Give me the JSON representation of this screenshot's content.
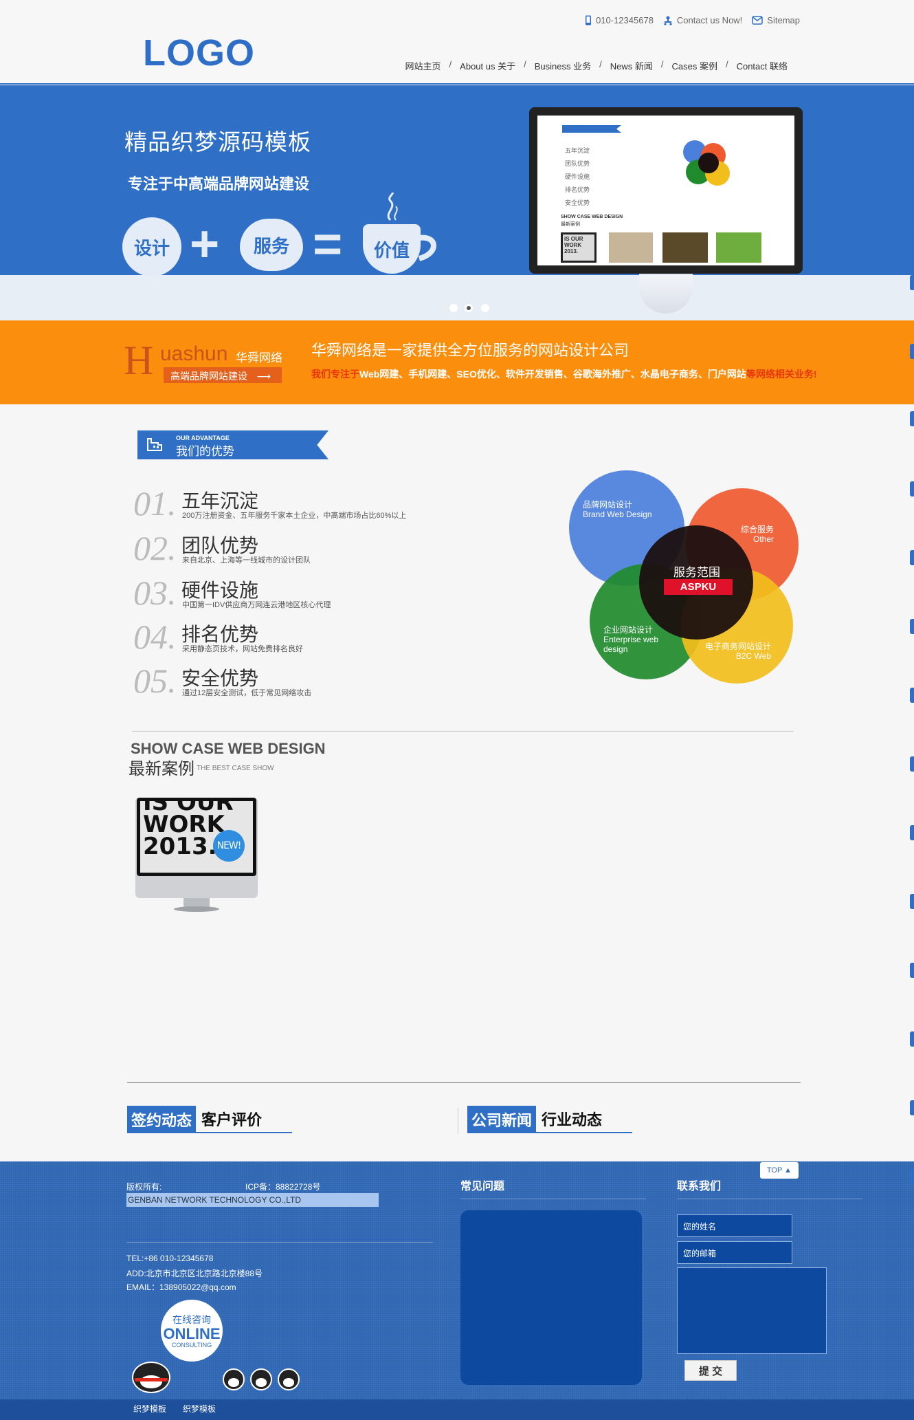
{
  "header": {
    "logo": "LOGO",
    "phone": "010-12345678",
    "contact": "Contact us Now!",
    "sitemap": "Sitemap",
    "nav": [
      "网站主页",
      "About us 关于",
      "Business 业务",
      "News 新闻",
      "Cases 案例",
      "Contact 联络"
    ],
    "separator": "/"
  },
  "banner": {
    "title": "精品织梦源码模板",
    "subtitle": "专注于中高端品牌网站建设",
    "equation": {
      "a": "设计",
      "plus": "+",
      "b": "服务",
      "equals": "=",
      "c": "价值"
    },
    "screen": {
      "items": [
        "五年沉淀",
        "团队优势",
        "硬件设施",
        "排名优势",
        "安全优势"
      ],
      "case_en": "SHOW CASE WEB DESIGN",
      "case_cn": "最新案例",
      "thumb_text": "IS OUR WORK 2013."
    },
    "slides": 3,
    "active_slide": 2
  },
  "promo": {
    "logo_h": "H",
    "logo_name": "uashun",
    "logo_cn": "华舜网络",
    "logo_tag": "高端品牌网站建设",
    "title": "华舜网络是一家提供全方位服务的网站设计公司",
    "desc_pre": "我们专注于",
    "desc_mid": "Web网建、手机网建、SEO优化、软件开发销售、谷歌海外推广、水晶电子商务、门户网站",
    "desc_post": "等网络相关业务!"
  },
  "advantages": {
    "badge_en": "OUR ADVANTAGE",
    "badge_cn": "我们的优势",
    "items": [
      {
        "num": "01.",
        "title": "五年沉淀",
        "desc": "200万注册资金、五年服务千家本土企业，中高端市场占比60%以上"
      },
      {
        "num": "02.",
        "title": "团队优势",
        "desc": "来自北京、上海等一线城市的设计团队"
      },
      {
        "num": "03.",
        "title": "硬件设施",
        "desc": "中国第一IDV供应商万网连云港地区核心代理"
      },
      {
        "num": "04.",
        "title": "排名优势",
        "desc": "采用静态页技术，网站免费排名良好"
      },
      {
        "num": "05.",
        "title": "安全优势",
        "desc": "通过12层安全测试，低于常见网络攻击"
      }
    ],
    "diagram": {
      "center_cn": "服务范围",
      "center_brand": "ASPKU",
      "brand_cn": "品牌网站设计",
      "brand_en": "Brand Web Design",
      "other_cn": "综合服务",
      "other_en": "Other",
      "ent_cn": "企业网站设计",
      "ent_en": "Enterprise web design",
      "b2c_cn": "电子商务网站设计",
      "b2c_en": "B2C Web",
      "colors": {
        "blue": "#4a7fdc",
        "red": "#ef5a2f",
        "green": "#1f8b2c",
        "yellow": "#f2be1b",
        "center": "#1c1010"
      }
    }
  },
  "cases": {
    "title_en": "SHOW CASE WEB DESIGN",
    "title_cn": "最新案例",
    "subtitle": "THE BEST CASE SHOW",
    "thumb_lines": [
      "IS OUR",
      "WORK",
      "2013."
    ],
    "badge": "NEW!"
  },
  "tabs": {
    "left_on": "签约动态",
    "left_off": "客户评价",
    "right_on": "公司新闻",
    "right_off": "行业动态"
  },
  "footer": {
    "copyright_label": "版权所有:",
    "icp": "ICP备：88822728号",
    "company_en": "GENBAN NETWORK TECHNOLOGY CO.,LTD",
    "tel": "TEL:+86 010-12345678",
    "add": "ADD:北京市北京区北京路北京楼88号",
    "email": "EMAIL：138905022@qq.com",
    "online_cn": "在线咨询",
    "online_en": "ONLINE",
    "online_sub": "CONSULTING",
    "faq_title": "常见问题",
    "contact_title": "联系我们",
    "name_placeholder": "您的姓名",
    "email_placeholder": "您的邮箱",
    "submit": "提 交",
    "top": "TOP ▲",
    "bottom_links": [
      "织梦模板",
      "织梦模板"
    ]
  },
  "colors": {
    "brand_blue": "#2f70c6",
    "orange": "#fc8e0d",
    "footer_blue": "#2f66b4"
  }
}
